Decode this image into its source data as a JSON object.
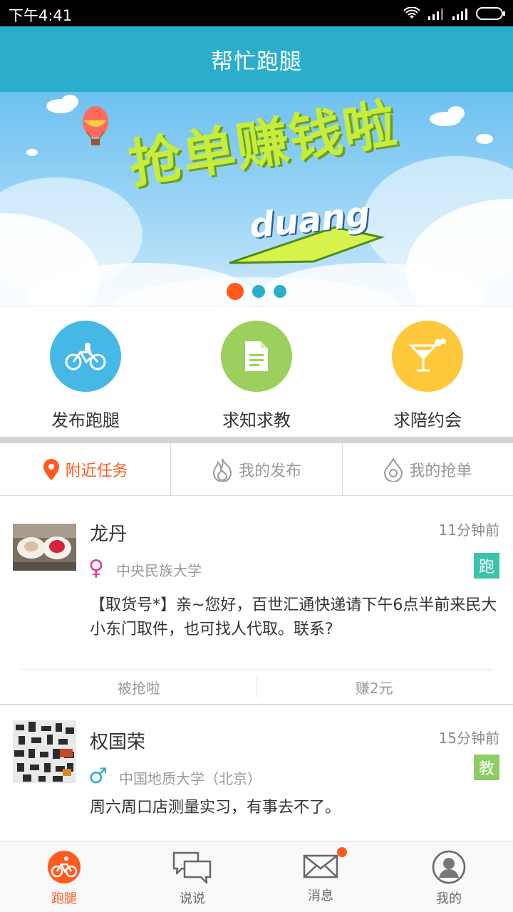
{
  "status_bar": {
    "time": "下午4:41"
  },
  "app": {
    "title": "帮忙跑腿"
  },
  "banner": {
    "headline": "抢单赚钱啦",
    "subline": "duang",
    "pager": {
      "count": 3,
      "active_index": 0
    }
  },
  "quick_actions": [
    {
      "label": "发布跑腿",
      "icon": "bicycle-icon",
      "color": "#45b8e6"
    },
    {
      "label": "求知求教",
      "icon": "document-icon",
      "color": "#9ccf5e"
    },
    {
      "label": "求陪约会",
      "icon": "cocktail-icon",
      "color": "#ffc83a"
    }
  ],
  "tabs": [
    {
      "label": "附近任务",
      "icon": "location-pin-icon",
      "active": true
    },
    {
      "label": "我的发布",
      "icon": "flame-icon",
      "active": false
    },
    {
      "label": "我的抢单",
      "icon": "water-drop-icon",
      "active": false
    }
  ],
  "tasks": [
    {
      "name": "龙丹",
      "time": "11分钟前",
      "gender": "female",
      "gender_symbol": "♀",
      "school": "中央民族大学",
      "tag": "跑",
      "tag_color": "#3ac5a9",
      "content": "【取货号*】亲~您好，百世汇通快递请下午6点半前来民大小东门取件，也可找人代取。联系?",
      "status": "被抢啦",
      "reward": "赚2元"
    },
    {
      "name": "权国荣",
      "time": "15分钟前",
      "gender": "male",
      "gender_symbol": "♂",
      "school": "中国地质大学（北京）",
      "tag": "教",
      "tag_color": "#8dcd64",
      "content": "周六周口店测量实习，有事去不了。"
    }
  ],
  "bottom_nav": [
    {
      "label": "跑腿",
      "icon": "bicycle-icon",
      "active": true
    },
    {
      "label": "说说",
      "icon": "chat-bubbles-icon",
      "active": false
    },
    {
      "label": "消息",
      "icon": "envelope-icon",
      "active": false,
      "badge": true
    },
    {
      "label": "我的",
      "icon": "user-avatar-icon",
      "active": false
    }
  ],
  "colors": {
    "primary": "#2aaecc",
    "accent": "#ff5a1e"
  }
}
